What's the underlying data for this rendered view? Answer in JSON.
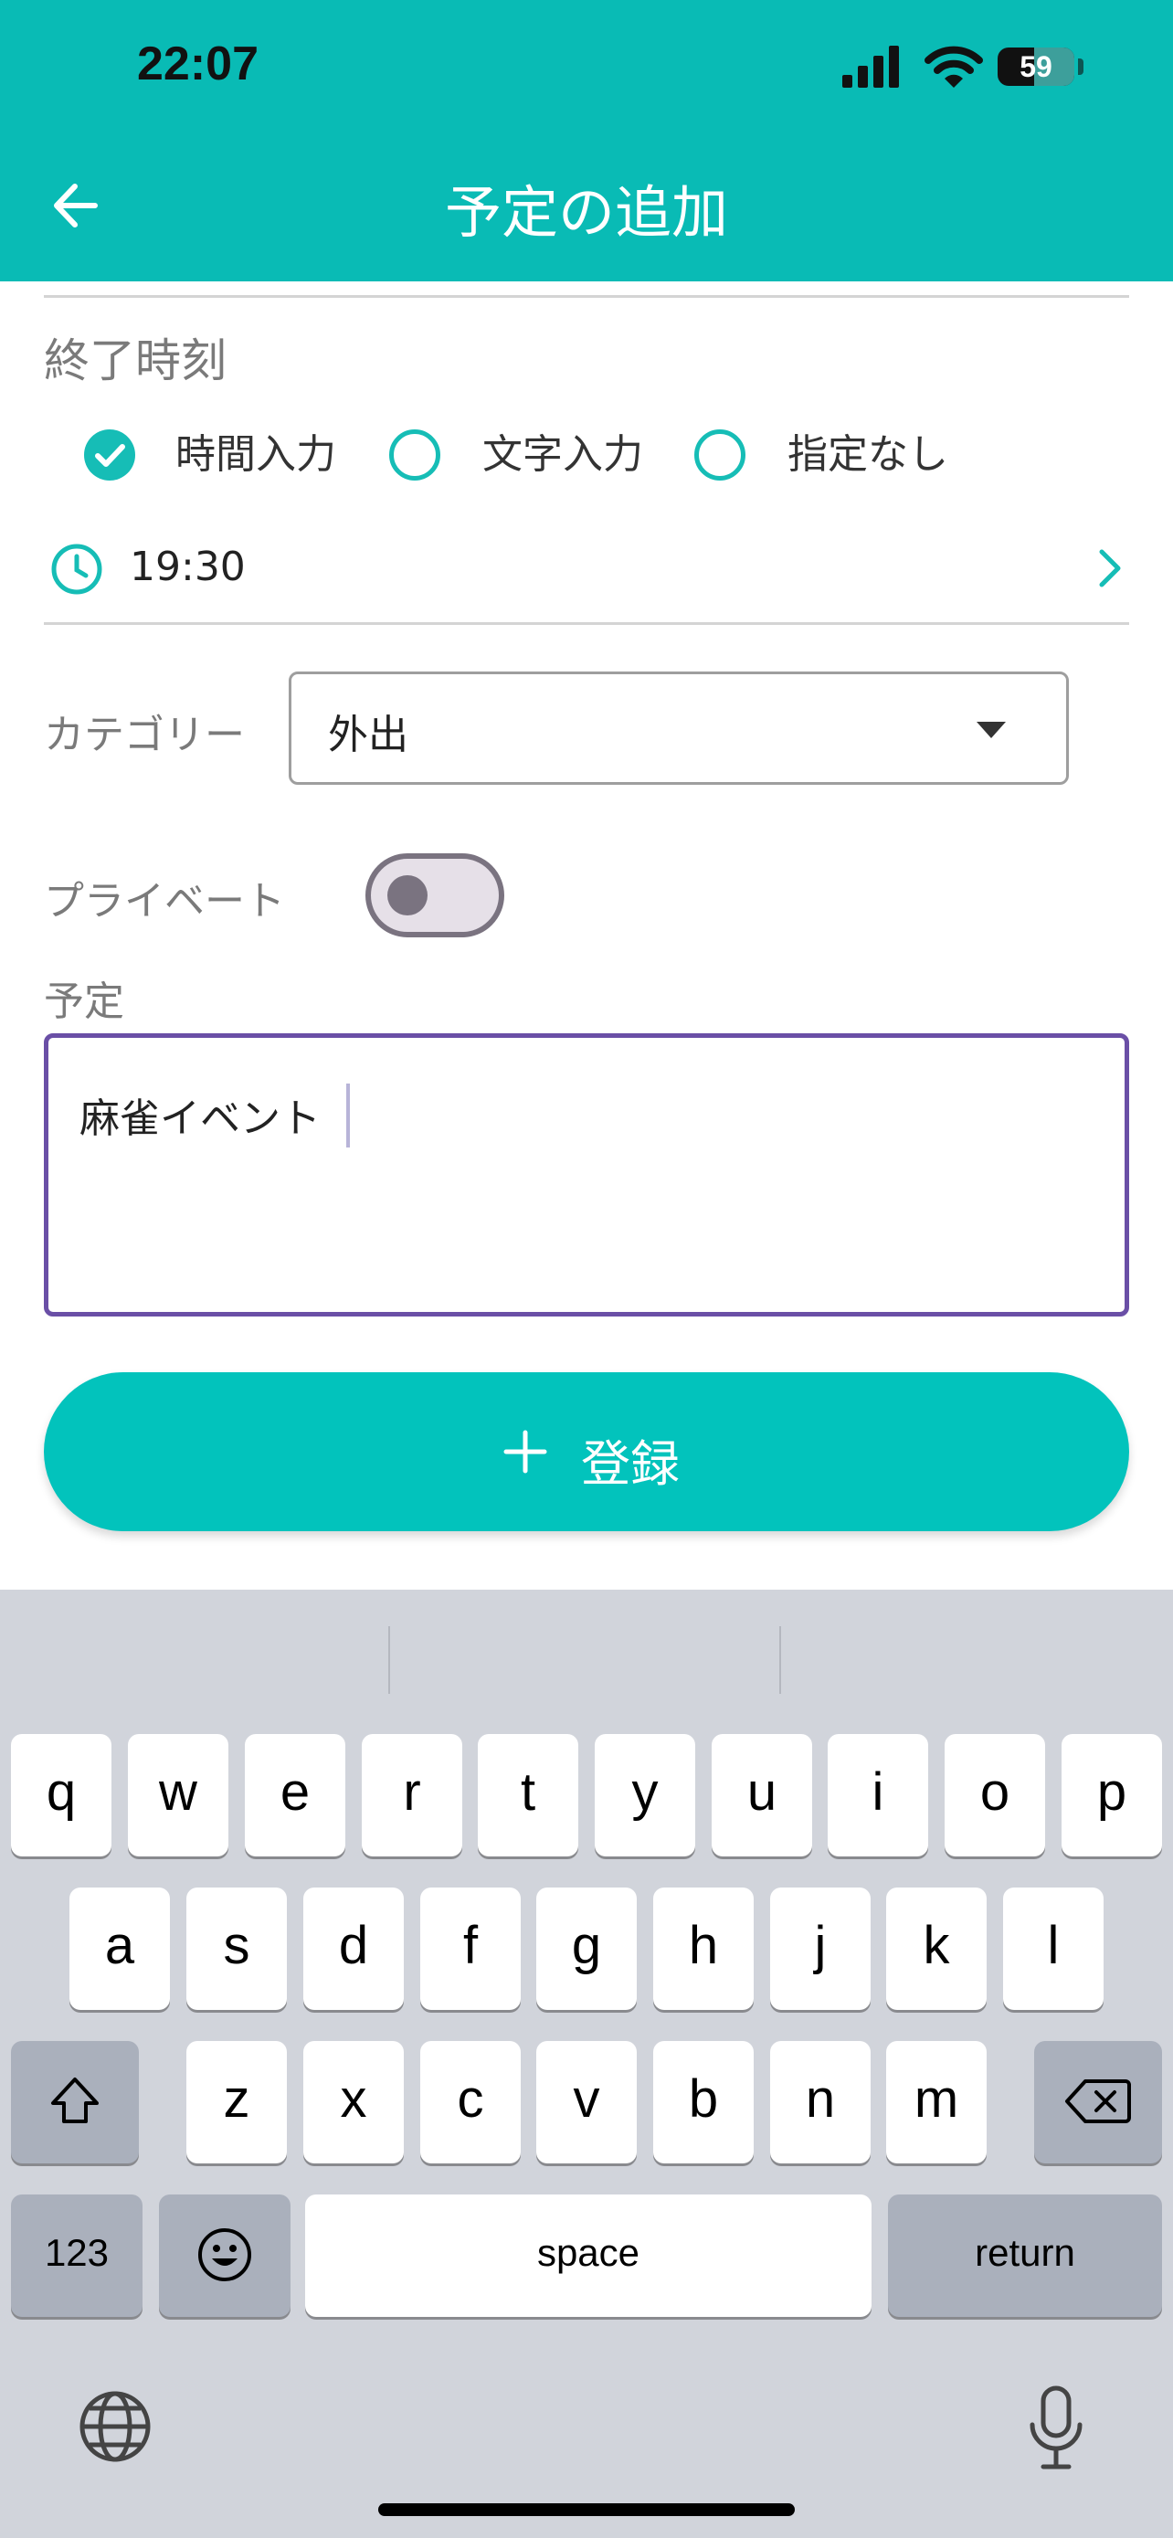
{
  "status_bar": {
    "time": "22:07",
    "battery": "59"
  },
  "header": {
    "title": "予定の追加",
    "color": "#09BBB5"
  },
  "end_time": {
    "label": "終了時刻",
    "options": [
      {
        "label": "時間入力",
        "selected": true
      },
      {
        "label": "文字入力",
        "selected": false
      },
      {
        "label": "指定なし",
        "selected": false
      }
    ],
    "value": "19:30"
  },
  "category": {
    "label": "カテゴリー",
    "value": "外出"
  },
  "private": {
    "label": "プライベート",
    "enabled": false
  },
  "schedule": {
    "label": "予定",
    "value": "麻雀イベント",
    "border_color": "#6A4FA6"
  },
  "register_button": {
    "label": "登録",
    "color": "#02C3BC"
  },
  "keyboard": {
    "row1": [
      "q",
      "w",
      "e",
      "r",
      "t",
      "y",
      "u",
      "i",
      "o",
      "p"
    ],
    "row2": [
      "a",
      "s",
      "d",
      "f",
      "g",
      "h",
      "j",
      "k",
      "l"
    ],
    "row3": [
      "z",
      "x",
      "c",
      "v",
      "b",
      "n",
      "m"
    ],
    "numbers_key": "123",
    "space_key": "space",
    "return_key": "return"
  }
}
